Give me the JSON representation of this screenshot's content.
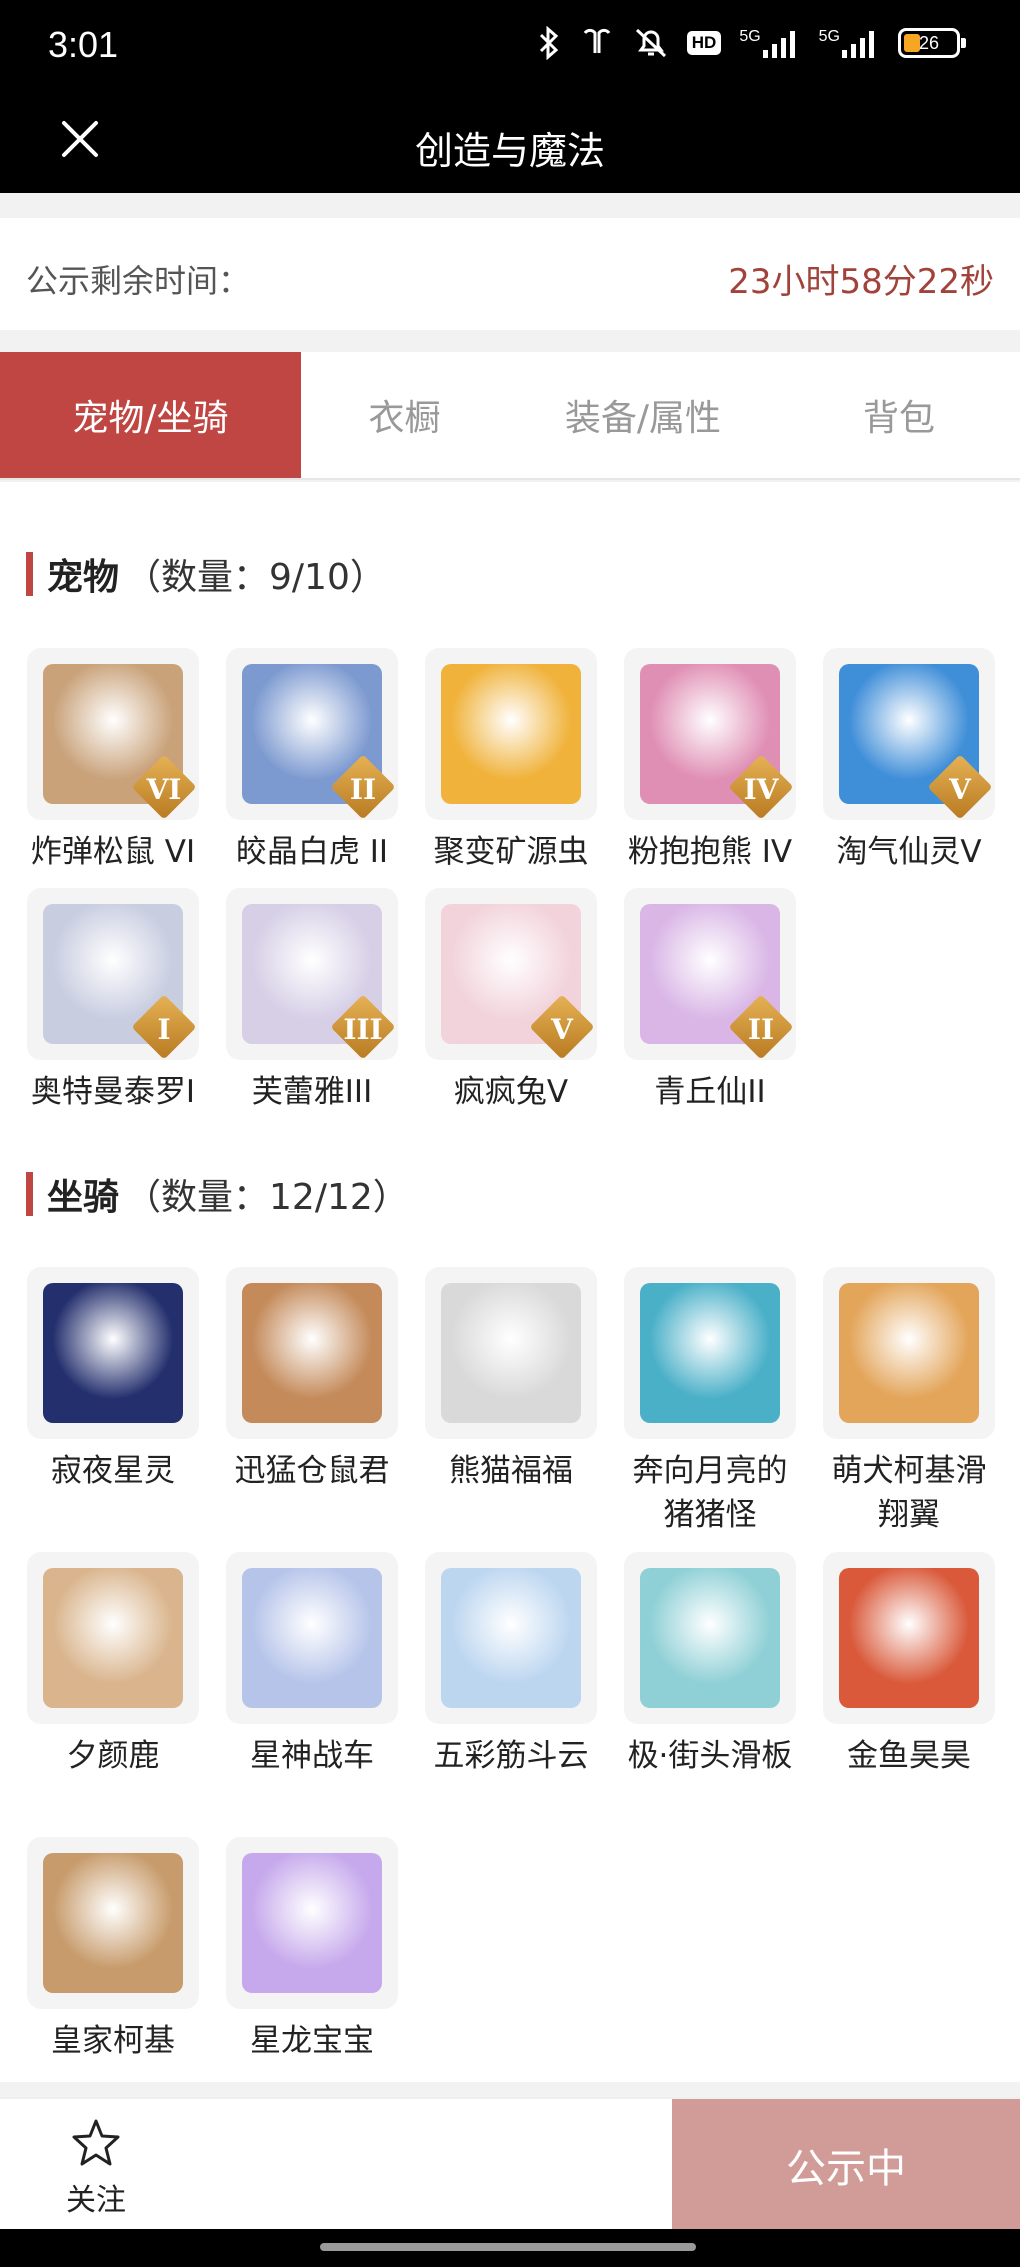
{
  "status_bar": {
    "time": "3:01",
    "network": [
      "5G",
      "5G"
    ],
    "hd_label": "HD",
    "battery": "26"
  },
  "header": {
    "title": "创造与魔法"
  },
  "timer": {
    "label": "公示剩余时间：",
    "value": "23小时58分22秒"
  },
  "tabs": [
    {
      "label": "宠物/坐骑",
      "active": true
    },
    {
      "label": "衣橱",
      "active": false
    },
    {
      "label": "装备/属性",
      "active": false
    },
    {
      "label": "背包",
      "active": false
    }
  ],
  "pets": {
    "title": "宠物",
    "count": "（数量：9/10）",
    "items": [
      {
        "name": "炸弹松鼠 VI",
        "tier": "VI",
        "color": "#c9a27a"
      },
      {
        "name": "皎晶白虎 II",
        "tier": "II",
        "color": "#7d9ad0"
      },
      {
        "name": "聚变矿源虫",
        "tier": "",
        "color": "#f0b23a"
      },
      {
        "name": "粉抱抱熊 IV",
        "tier": "IV",
        "color": "#e08fb4"
      },
      {
        "name": "淘气仙灵V",
        "tier": "V",
        "color": "#3f8ed8"
      },
      {
        "name": "奥特曼泰罗I",
        "tier": "I",
        "color": "#c8cde0"
      },
      {
        "name": "芙蕾雅III",
        "tier": "III",
        "color": "#d6cfe6"
      },
      {
        "name": "疯疯兔V",
        "tier": "V",
        "color": "#f2d3dc"
      },
      {
        "name": "青丘仙II",
        "tier": "II",
        "color": "#d9b6e6"
      }
    ]
  },
  "mounts": {
    "title": "坐骑",
    "count": "（数量：12/12）",
    "items": [
      {
        "name": "寂夜星灵",
        "color": "#24306e"
      },
      {
        "name": "迅猛仓鼠君",
        "color": "#c48a5a"
      },
      {
        "name": "熊猫福福",
        "color": "#d9d9d9"
      },
      {
        "name": "奔向月亮的猪猪怪",
        "color": "#4ab0c8"
      },
      {
        "name": "萌犬柯基滑翔翼",
        "color": "#e3a55a"
      },
      {
        "name": "夕颜鹿",
        "color": "#d9b48c"
      },
      {
        "name": "星神战车",
        "color": "#b6c4ea"
      },
      {
        "name": "五彩筋斗云",
        "color": "#bcd6f0"
      },
      {
        "name": "极·街头滑板",
        "color": "#8fd0d6"
      },
      {
        "name": "金鱼昊昊",
        "color": "#d9593a"
      },
      {
        "name": "皇家柯基",
        "color": "#c79b6b"
      },
      {
        "name": "星龙宝宝",
        "color": "#c6a9ec"
      }
    ]
  },
  "bottom": {
    "follow_label": "关注",
    "status_button": "公示中"
  }
}
